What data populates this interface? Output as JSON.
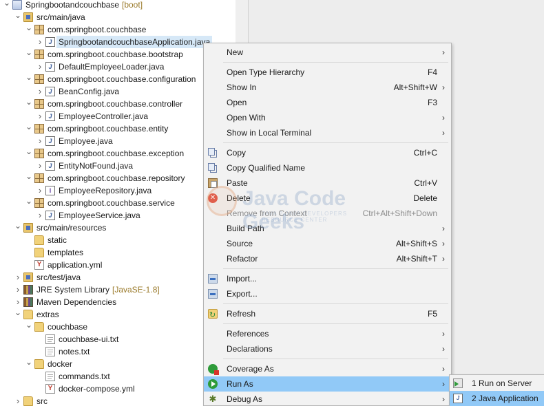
{
  "explorer": {
    "rows": [
      {
        "label": "Springbootandcouchbase",
        "decoration": "[boot]",
        "icon": "project-icon",
        "twisty": "expanded",
        "indent": 0
      },
      {
        "label": "src/main/java",
        "icon": "source-folder-icon",
        "twisty": "expanded",
        "indent": 1
      },
      {
        "label": "com.springboot.couchbase",
        "icon": "package-icon",
        "twisty": "expanded",
        "indent": 2
      },
      {
        "label": "SpringbootandcouchbaseApplication.java",
        "icon": "java-file-icon",
        "twisty": "collapsed",
        "indent": 3,
        "selected": true
      },
      {
        "label": "com.springboot.couchbase.bootstrap",
        "icon": "package-icon",
        "twisty": "expanded",
        "indent": 2
      },
      {
        "label": "DefaultEmployeeLoader.java",
        "icon": "java-file-icon",
        "twisty": "collapsed",
        "indent": 3
      },
      {
        "label": "com.springboot.couchbase.configuration",
        "icon": "package-icon",
        "twisty": "expanded",
        "indent": 2
      },
      {
        "label": "BeanConfig.java",
        "icon": "java-file-icon",
        "twisty": "collapsed",
        "indent": 3
      },
      {
        "label": "com.springboot.couchbase.controller",
        "icon": "package-icon",
        "twisty": "expanded",
        "indent": 2
      },
      {
        "label": "EmployeeController.java",
        "icon": "java-file-icon",
        "twisty": "collapsed",
        "indent": 3
      },
      {
        "label": "com.springboot.couchbase.entity",
        "icon": "package-icon",
        "twisty": "expanded",
        "indent": 2
      },
      {
        "label": "Employee.java",
        "icon": "java-file-icon",
        "twisty": "collapsed",
        "indent": 3
      },
      {
        "label": "com.springboot.couchbase.exception",
        "icon": "package-icon",
        "twisty": "expanded",
        "indent": 2
      },
      {
        "label": "EntityNotFound.java",
        "icon": "java-file-icon",
        "twisty": "collapsed",
        "indent": 3
      },
      {
        "label": "com.springboot.couchbase.repository",
        "icon": "package-icon",
        "twisty": "expanded",
        "indent": 2
      },
      {
        "label": "EmployeeRepository.java",
        "icon": "java-interface-icon",
        "twisty": "collapsed",
        "indent": 3
      },
      {
        "label": "com.springboot.couchbase.service",
        "icon": "package-icon",
        "twisty": "expanded",
        "indent": 2
      },
      {
        "label": "EmployeeService.java",
        "icon": "java-file-icon",
        "twisty": "collapsed",
        "indent": 3
      },
      {
        "label": "src/main/resources",
        "icon": "source-folder-icon",
        "twisty": "expanded",
        "indent": 1
      },
      {
        "label": "static",
        "icon": "folder-icon",
        "twisty": "none",
        "indent": 2
      },
      {
        "label": "templates",
        "icon": "folder-icon",
        "twisty": "none",
        "indent": 2
      },
      {
        "label": "application.yml",
        "icon": "yaml-file-icon",
        "twisty": "none",
        "indent": 2
      },
      {
        "label": "src/test/java",
        "icon": "source-folder-icon",
        "twisty": "collapsed",
        "indent": 1
      },
      {
        "label": "JRE System Library",
        "decoration": "[JavaSE-1.8]",
        "icon": "library-icon",
        "twisty": "collapsed",
        "indent": 1
      },
      {
        "label": "Maven Dependencies",
        "icon": "library-icon",
        "twisty": "collapsed",
        "indent": 1
      },
      {
        "label": "extras",
        "icon": "folder-icon",
        "twisty": "expanded",
        "indent": 1
      },
      {
        "label": "couchbase",
        "icon": "folder-icon",
        "twisty": "expanded",
        "indent": 2
      },
      {
        "label": "couchbase-ui.txt",
        "icon": "text-file-icon",
        "twisty": "none",
        "indent": 3
      },
      {
        "label": "notes.txt",
        "icon": "text-file-icon",
        "twisty": "none",
        "indent": 3
      },
      {
        "label": "docker",
        "icon": "folder-icon",
        "twisty": "expanded",
        "indent": 2
      },
      {
        "label": "commands.txt",
        "icon": "text-file-icon",
        "twisty": "none",
        "indent": 3
      },
      {
        "label": "docker-compose.yml",
        "icon": "yaml-file-icon",
        "twisty": "none",
        "indent": 3
      },
      {
        "label": "src",
        "icon": "folder-icon",
        "twisty": "collapsed",
        "indent": 1
      }
    ]
  },
  "menu": {
    "new": "New",
    "open_type_hierarchy": "Open Type Hierarchy",
    "open_type_hierarchy_sc": "F4",
    "show_in": "Show In",
    "show_in_sc": "Alt+Shift+W",
    "open": "Open",
    "open_sc": "F3",
    "open_with": "Open With",
    "show_in_local_terminal": "Show in Local Terminal",
    "copy": "Copy",
    "copy_sc": "Ctrl+C",
    "copy_qualified_name": "Copy Qualified Name",
    "paste": "Paste",
    "paste_sc": "Ctrl+V",
    "delete": "Delete",
    "delete_sc": "Delete",
    "remove_from_context": "Remove from Context",
    "remove_from_context_sc": "Ctrl+Alt+Shift+Down",
    "build_path": "Build Path",
    "source": "Source",
    "source_sc": "Alt+Shift+S",
    "refactor": "Refactor",
    "refactor_sc": "Alt+Shift+T",
    "import": "Import...",
    "export": "Export...",
    "refresh": "Refresh",
    "refresh_sc": "F5",
    "references": "References",
    "declarations": "Declarations",
    "coverage_as": "Coverage As",
    "run_as": "Run As",
    "debug_as": "Debug As",
    "submenu_arrow": "›"
  },
  "submenu": {
    "run_on_server": "1 Run on Server",
    "java_application": "2 Java Application"
  },
  "watermark": {
    "name": "Java Code Geeks",
    "tagline": "JAVA 2 JAVA DEVELOPERS RESOURCE CENTER"
  },
  "colors": {
    "menu_highlight": "#91c9f7",
    "selection": "#d6e8f7",
    "menu_background": "#f2f2f2"
  }
}
